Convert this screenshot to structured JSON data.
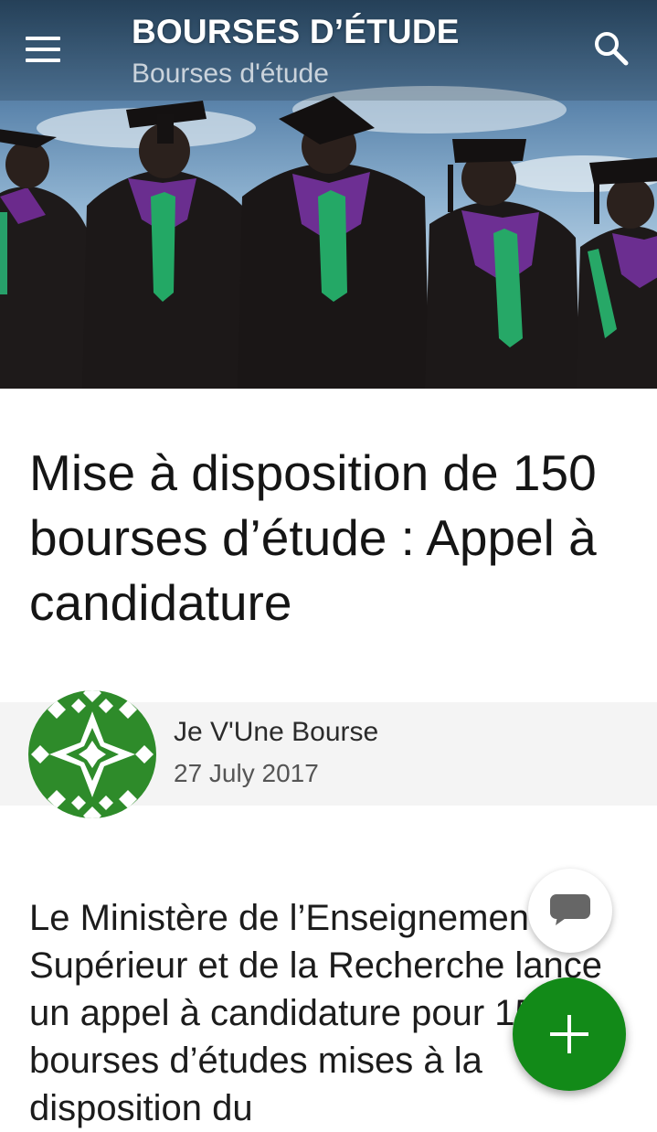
{
  "header": {
    "title": "BOURSES D’ÉTUDE",
    "subtitle": "Bourses d'étude",
    "menu_icon": "hamburger-menu-icon",
    "search_icon": "search-icon"
  },
  "hero": {
    "image": "graduates-in-caps-and-gowns"
  },
  "article": {
    "title": "Mise à disposition de 150 bourses d’étude : Appel à candidature",
    "author": "Je V'Une Bourse",
    "date": "27 July 2017",
    "body": "Le Ministère de l’Enseignement Supérieur et de la Recherche lance un appel à candidature pour 150 bourses d’études mises à la disposition du"
  },
  "fabs": {
    "comment_icon": "comment-icon",
    "add_icon": "plus-icon"
  },
  "colors": {
    "accent": "#128a18",
    "avatar_green": "#2e8b2a",
    "author_bar": "#f4f4f4"
  }
}
